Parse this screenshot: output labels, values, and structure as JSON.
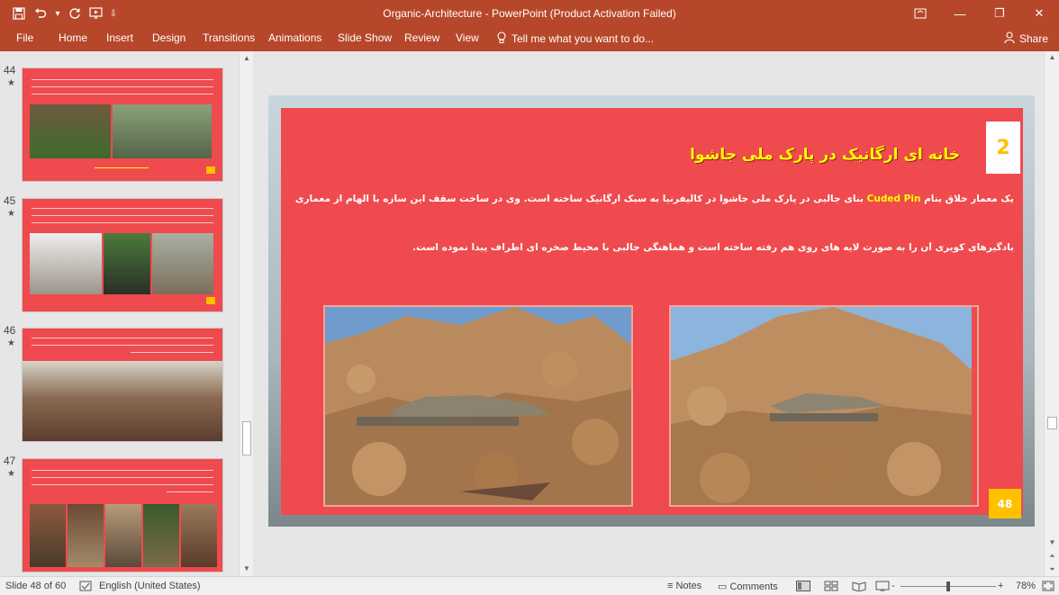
{
  "app": {
    "title": "Organic-Architecture - PowerPoint (Product Activation Failed)"
  },
  "qat": {
    "save_icon": "save-icon",
    "undo_icon": "undo-icon",
    "redo_icon": "redo-icon",
    "start_icon": "start-from-beginning-icon"
  },
  "window": {
    "restore_ribbon_icon": "ribbon-display-icon",
    "minimize": "—",
    "maximize": "❐",
    "close": "✕"
  },
  "ribbon": {
    "tabs": [
      "File",
      "Home",
      "Insert",
      "Design",
      "Transitions",
      "Animations",
      "Slide Show",
      "Review",
      "View"
    ],
    "tellme": "Tell me what you want to do...",
    "share": "Share"
  },
  "thumbnails": [
    {
      "number": "44",
      "star": "★"
    },
    {
      "number": "45",
      "star": "★"
    },
    {
      "number": "46",
      "star": "★"
    },
    {
      "number": "47",
      "star": "★"
    }
  ],
  "slide": {
    "number_box": "2",
    "title": "خانه ای ارگانیک در پارک ملی جاشوا",
    "para1_before": "یک معمار خلاق بنام ",
    "para1_highlight": "Cuded Pin",
    "para1_after": " بنای جالبی در پارک ملی جاشوا در کالیفرنیا به سبک ارگانیک ساخته است. وی در ساخت سقف این سازه با الهام از معماری",
    "para2": "بادگیرهای کویری آن را به صورت لایه های روی هم رفته ساخته است و هماهنگی جالبی با محیط صخره ای اطراف پیدا نموده است.",
    "page_badge": "48"
  },
  "status": {
    "slide_of": "Slide 48 of 60",
    "language": "English (United States)",
    "notes": "Notes",
    "comments": "Comments",
    "zoom": "78%",
    "zoom_minus": "-",
    "zoom_plus": "+"
  }
}
